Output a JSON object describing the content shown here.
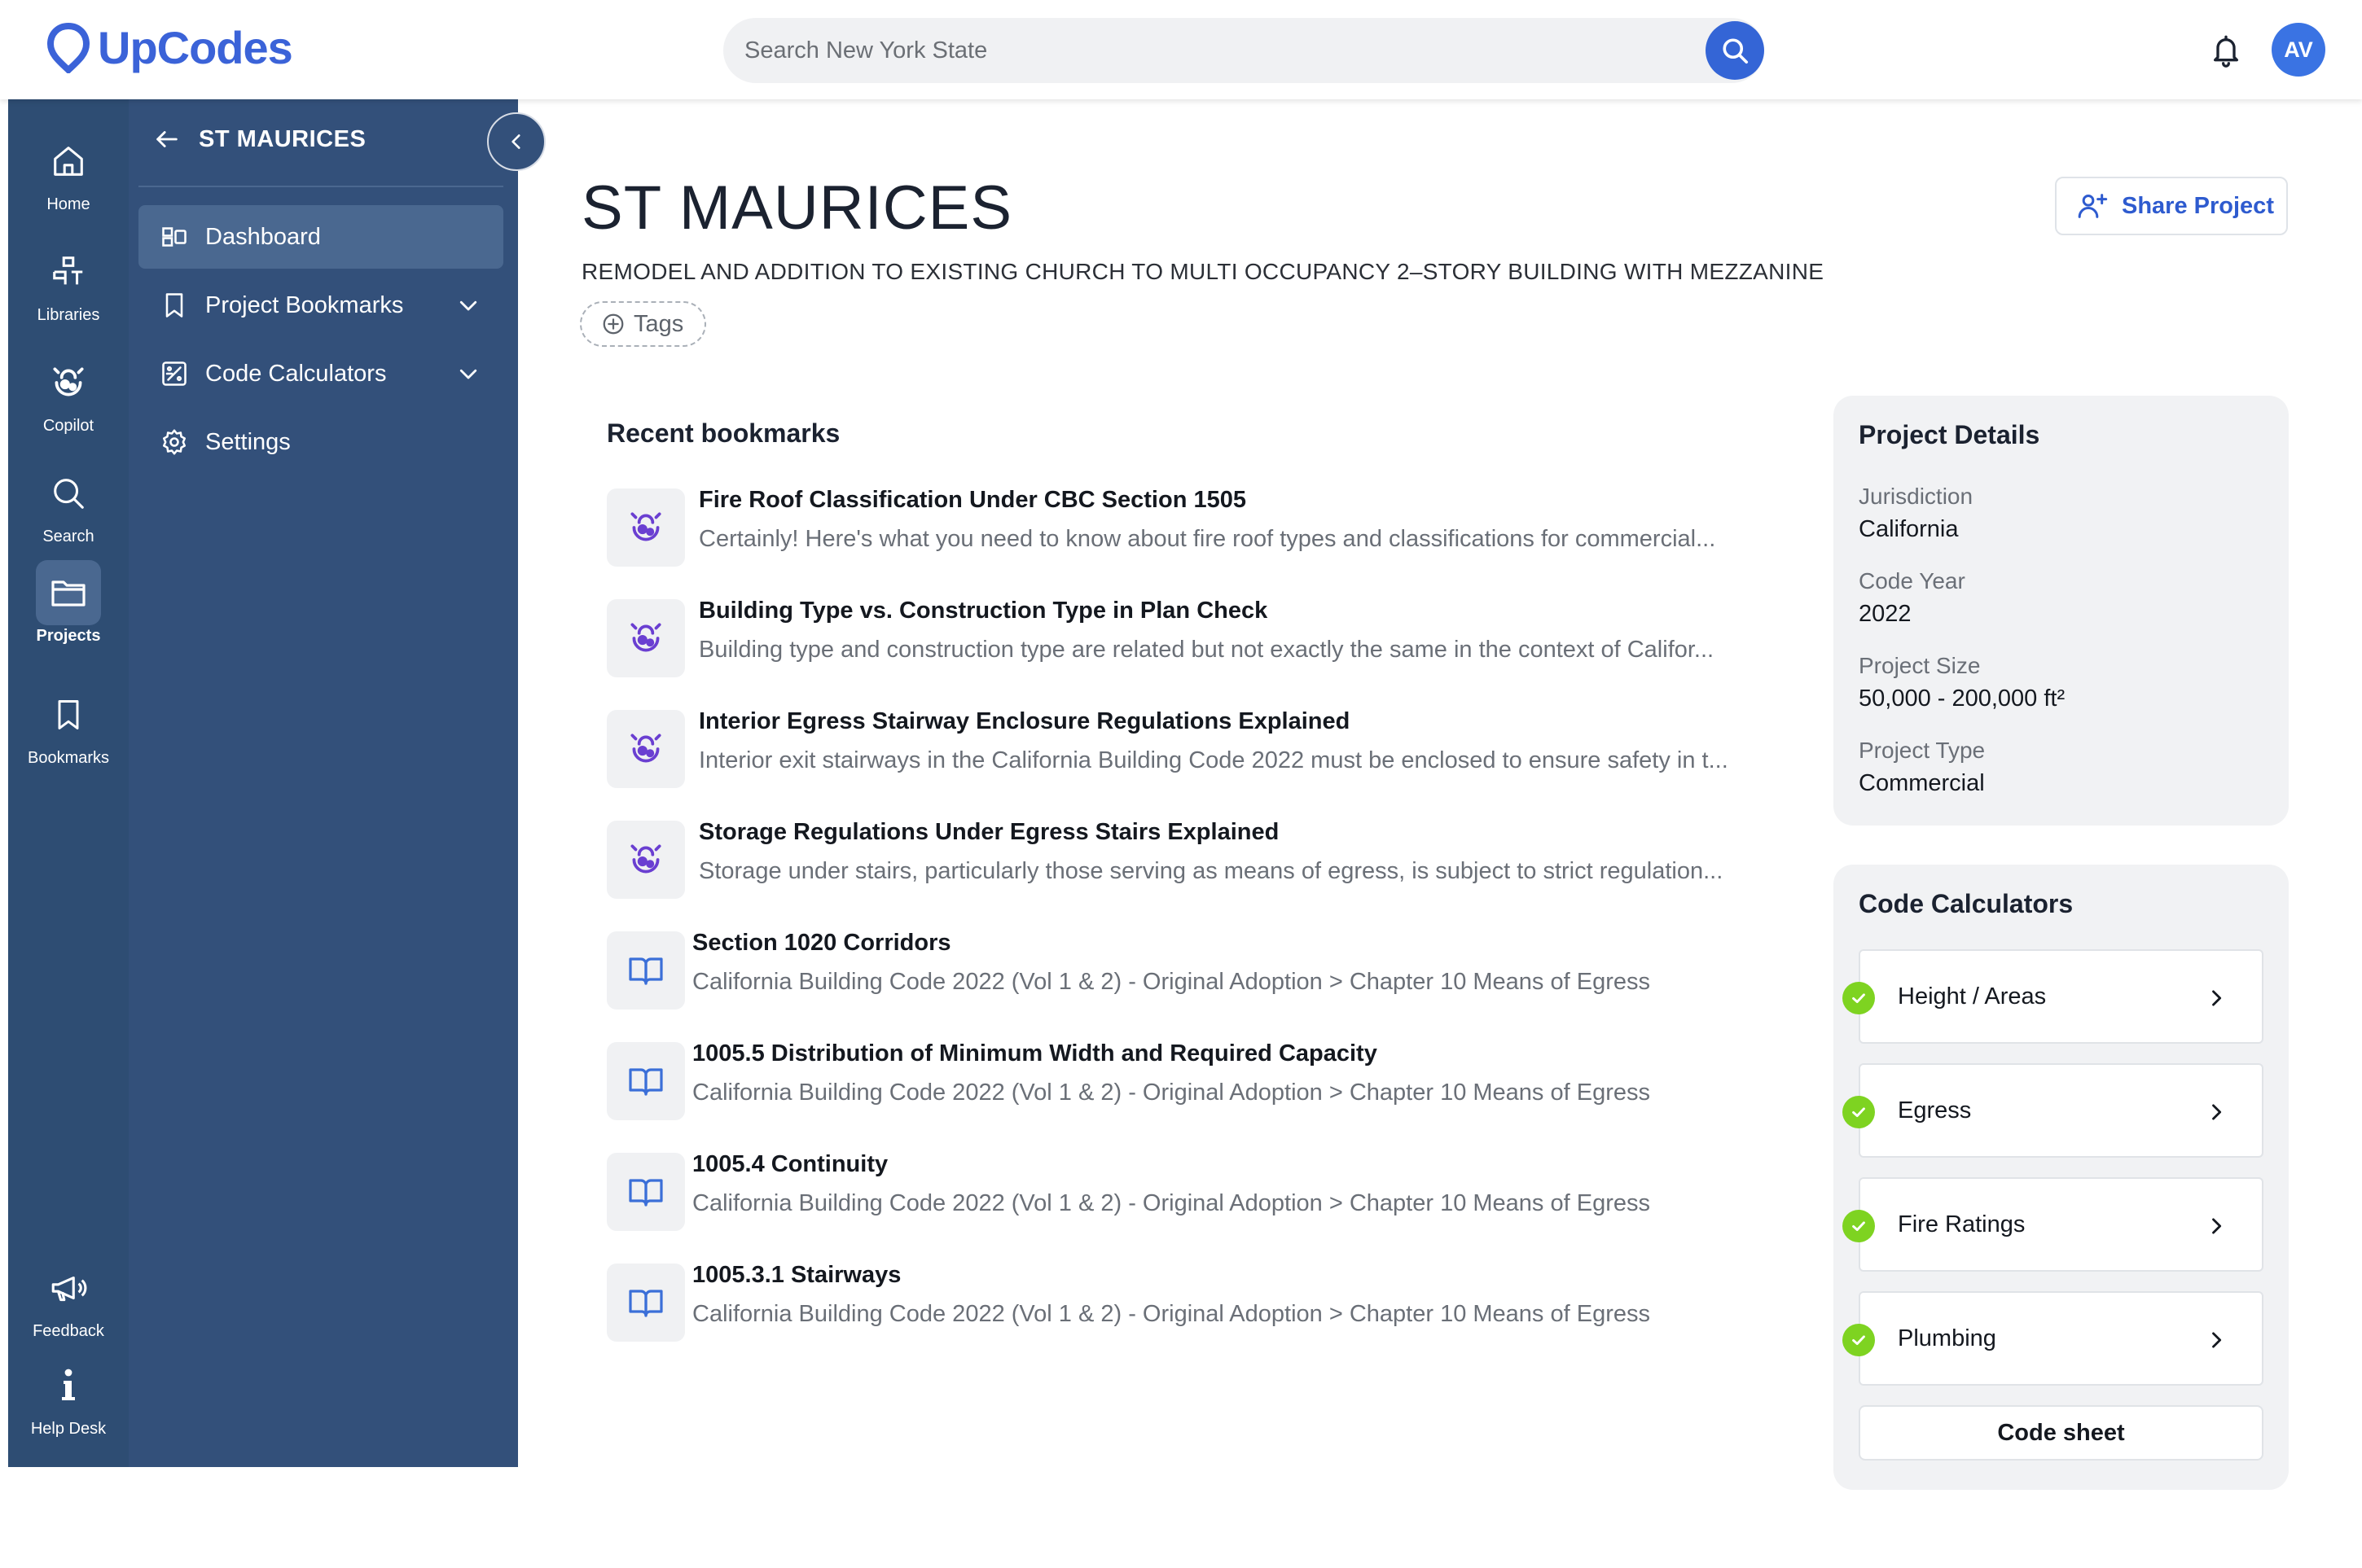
{
  "brand": {
    "name": "UpCodes",
    "color": "#3b63d8"
  },
  "header": {
    "search_placeholder": "Search New York State",
    "avatar_initials": "AV"
  },
  "rail": {
    "items": [
      {
        "label": "Home",
        "icon": "home-icon",
        "active": false
      },
      {
        "label": "Libraries",
        "icon": "libraries-icon",
        "active": false
      },
      {
        "label": "Copilot",
        "icon": "copilot-icon",
        "active": false
      },
      {
        "label": "Search",
        "icon": "search-icon",
        "active": false
      },
      {
        "label": "Projects",
        "icon": "folder-icon",
        "active": true
      },
      {
        "label": "Bookmarks",
        "icon": "bookmark-icon",
        "active": false
      }
    ],
    "bottom": [
      {
        "label": "Feedback",
        "icon": "megaphone-icon"
      },
      {
        "label": "Help Desk",
        "icon": "info-icon"
      }
    ]
  },
  "panel": {
    "title": "ST MAURICES",
    "nav": [
      {
        "label": "Dashboard",
        "icon": "dashboard-icon",
        "active": true
      },
      {
        "label": "Project Bookmarks",
        "icon": "bookmark-icon",
        "expandable": true
      },
      {
        "label": "Code Calculators",
        "icon": "calculator-icon",
        "expandable": true
      },
      {
        "label": "Settings",
        "icon": "gear-icon"
      }
    ]
  },
  "project": {
    "title": "ST MAURICES",
    "description": "REMODEL AND ADDITION TO EXISTING CHURCH TO MULTI OCCUPANCY 2–STORY BUILDING WITH MEZZANINE",
    "tags_label": "Tags",
    "share_label": "Share Project"
  },
  "recent": {
    "title": "Recent bookmarks",
    "items": [
      {
        "type": "copilot",
        "title": "Fire Roof Classification Under CBC Section 1505",
        "subtitle": "Certainly! Here's what you need to know about fire roof types and classifications for commercial..."
      },
      {
        "type": "copilot",
        "title": "Building Type vs. Construction Type in Plan Check",
        "subtitle": "Building type and construction type are related but not exactly the same in the context of Califor..."
      },
      {
        "type": "copilot",
        "title": "Interior Egress Stairway Enclosure Regulations Explained",
        "subtitle": "Interior exit stairways in the California Building Code 2022 must be enclosed to ensure safety in t..."
      },
      {
        "type": "copilot",
        "title": "Storage Regulations Under Egress Stairs Explained",
        "subtitle": "Storage under stairs, particularly those serving as means of egress, is subject to strict regulation..."
      },
      {
        "type": "book",
        "title": "Section 1020 Corridors",
        "subtitle": "California Building Code 2022 (Vol 1 & 2) - Original Adoption > Chapter 10 Means of Egress"
      },
      {
        "type": "book",
        "title": "1005.5 Distribution of Minimum Width and Required Capacity",
        "subtitle": "California Building Code 2022 (Vol 1 & 2) - Original Adoption > Chapter 10 Means of Egress"
      },
      {
        "type": "book",
        "title": "1005.4 Continuity",
        "subtitle": "California Building Code 2022 (Vol 1 & 2) - Original Adoption > Chapter 10 Means of Egress"
      },
      {
        "type": "book",
        "title": "1005.3.1 Stairways",
        "subtitle": "California Building Code 2022 (Vol 1 & 2) - Original Adoption > Chapter 10 Means of Egress"
      }
    ]
  },
  "details": {
    "title": "Project Details",
    "fields": [
      {
        "label": "Jurisdiction",
        "value": "California"
      },
      {
        "label": "Code Year",
        "value": "2022"
      },
      {
        "label": "Project Size",
        "value": "50,000 - 200,000 ft²"
      },
      {
        "label": "Project Type",
        "value": "Commercial"
      }
    ]
  },
  "calculators": {
    "title": "Code Calculators",
    "items": [
      {
        "label": "Height / Areas",
        "complete": true
      },
      {
        "label": "Egress",
        "complete": true
      },
      {
        "label": "Fire Ratings",
        "complete": true
      },
      {
        "label": "Plumbing",
        "complete": true
      }
    ],
    "code_sheet_label": "Code sheet",
    "check_color": "#7ed321"
  }
}
